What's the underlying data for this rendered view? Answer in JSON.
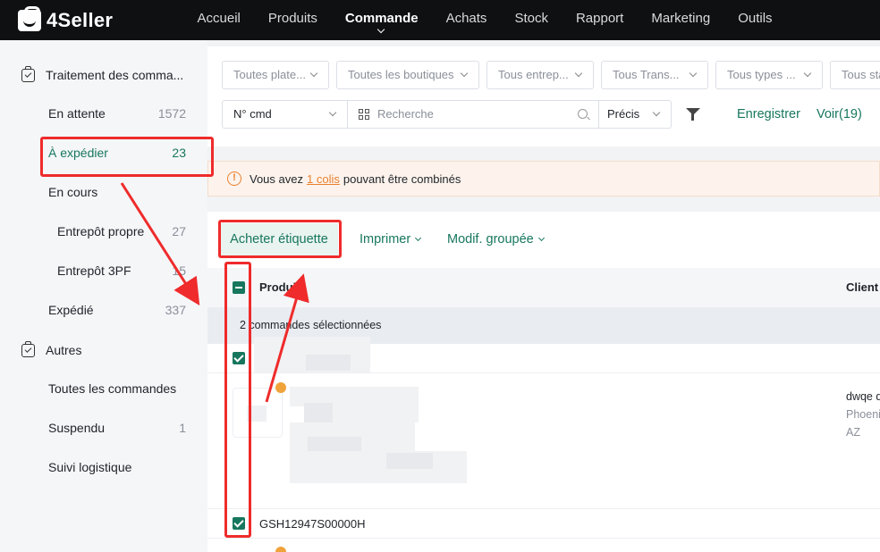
{
  "app": {
    "name": "4Seller"
  },
  "nav": {
    "items": [
      {
        "label": "Accueil",
        "active": false
      },
      {
        "label": "Produits",
        "active": false
      },
      {
        "label": "Commande",
        "active": true
      },
      {
        "label": "Achats",
        "active": false
      },
      {
        "label": "Stock",
        "active": false
      },
      {
        "label": "Rapport",
        "active": false
      },
      {
        "label": "Marketing",
        "active": false
      },
      {
        "label": "Outils",
        "active": false
      }
    ]
  },
  "sidebar": {
    "group1": "Traitement des comma...",
    "items": [
      {
        "label": "En attente",
        "count": "1572"
      },
      {
        "label": "À expédier",
        "count": "23",
        "active": true
      },
      {
        "label": "En cours",
        "count": ""
      },
      {
        "label": "Entrepôt propre",
        "count": "27"
      },
      {
        "label": "Entrepôt 3PF",
        "count": "15"
      },
      {
        "label": "Expédié",
        "count": "337"
      }
    ],
    "group2": "Autres",
    "others": [
      {
        "label": "Toutes les commandes",
        "count": ""
      },
      {
        "label": "Suspendu",
        "count": "1"
      },
      {
        "label": "Suivi logistique",
        "count": ""
      }
    ]
  },
  "filters": {
    "selects": [
      "Toutes plate...",
      "Toutes les boutiques",
      "Tous entrep...",
      "Tous Trans...",
      "Tous types ...",
      "Tous sta"
    ],
    "search_field": "N° cmd",
    "search_placeholder": "Recherche",
    "match_mode": "Précis",
    "save_label": "Enregistrer",
    "view_label": "Voir(19)"
  },
  "alert": {
    "prefix": "Vous avez",
    "link": "1 colis",
    "suffix": "pouvant être combinés"
  },
  "actions": {
    "buy_label": "Acheter étiquette",
    "print_label": "Imprimer",
    "bulk_edit_label": "Modif. groupée"
  },
  "table": {
    "col_product": "Produit",
    "col_client": "Client",
    "selected_text": "2 commandes sélectionnées",
    "client_lines": [
      "dwqe d",
      "Phoeni",
      "AZ"
    ],
    "order_id": "GSH12947S00000H"
  },
  "colors": {
    "accent": "#17775e",
    "topbar": "#0f1012",
    "alert": "#e8812e",
    "annotation": "#ef2b2b"
  }
}
